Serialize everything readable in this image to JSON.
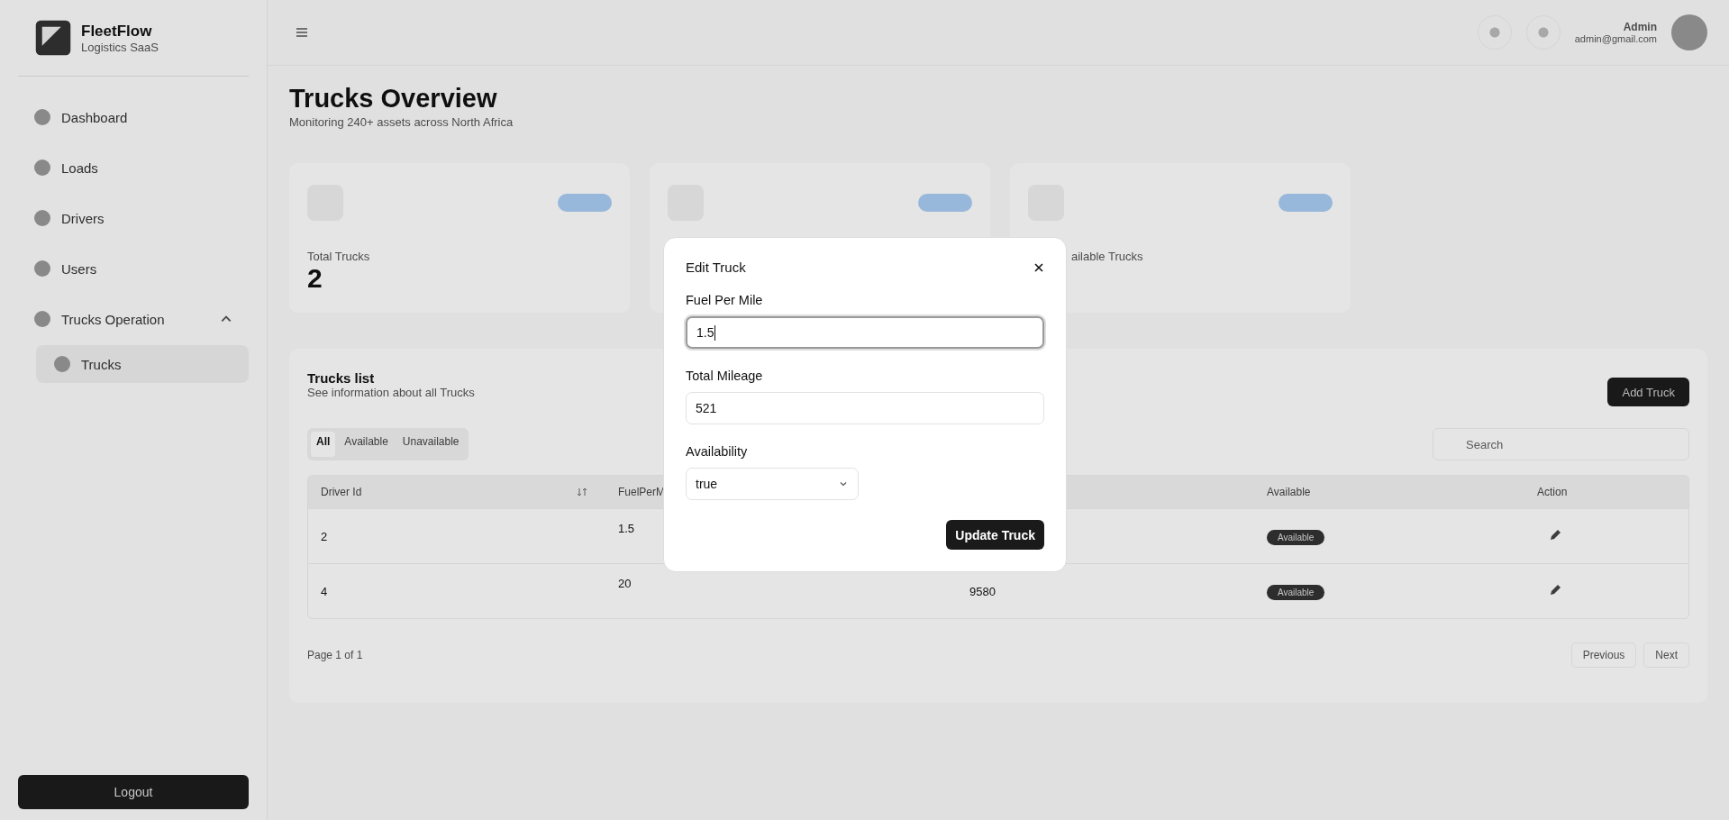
{
  "sidebar": {
    "brand": {
      "name": "FleetFlow",
      "tagline": "Logistics SaaS"
    },
    "items": [
      {
        "label": "Dashboard",
        "selected": false
      },
      {
        "label": "Loads",
        "selected": false
      },
      {
        "label": "Drivers",
        "selected": false
      },
      {
        "label": "Users",
        "selected": false
      },
      {
        "label": "Trucks Operation",
        "selected": false,
        "expanded": true,
        "children": [
          {
            "label": "Trucks",
            "selected": true
          }
        ]
      }
    ],
    "logout": "Logout"
  },
  "header": {
    "user": {
      "name": "Admin",
      "email": "admin@gmail.com"
    }
  },
  "page": {
    "title": "Trucks Overview",
    "subtitle": "Monitoring 240+ assets across North Africa",
    "stats": [
      {
        "label": "Total Trucks",
        "value": "2",
        "badge": true
      },
      {
        "badge": true
      },
      {
        "label": "ailable Trucks",
        "badge": true
      }
    ],
    "list": {
      "title": "Trucks list",
      "subtitle": "See information about all Trucks",
      "add_button": "Add Truck",
      "filters": [
        {
          "label": "All",
          "selected": true
        },
        {
          "label": "Available",
          "selected": false
        },
        {
          "label": "Unavailable",
          "selected": false
        }
      ],
      "search": {
        "placeholder": "Search"
      },
      "columns": [
        {
          "label": "Driver Id",
          "sortable": true
        },
        {
          "label": "FuelPerM"
        },
        {},
        {
          "label": "Available"
        },
        {
          "label": "Action"
        }
      ],
      "rows": [
        {
          "cells": [
            "2",
            "1.5",
            null
          ],
          "badge": "Available"
        },
        {
          "cells": [
            "4",
            "20",
            "9580"
          ],
          "badge": "Available"
        }
      ],
      "page_info": "Page 1 of 1",
      "prev": "Previous",
      "next": "Next"
    }
  },
  "modal": {
    "title": "Edit Truck",
    "fields": [
      {
        "kind": "input",
        "label": "Fuel Per Mile",
        "value": "1.5",
        "focused": true
      },
      {
        "kind": "input",
        "label": "Total Mileage",
        "value": "521",
        "focused": false
      },
      {
        "kind": "select",
        "label": "Availability",
        "value": "true",
        "focused": false
      }
    ],
    "submit": "Update Truck"
  }
}
